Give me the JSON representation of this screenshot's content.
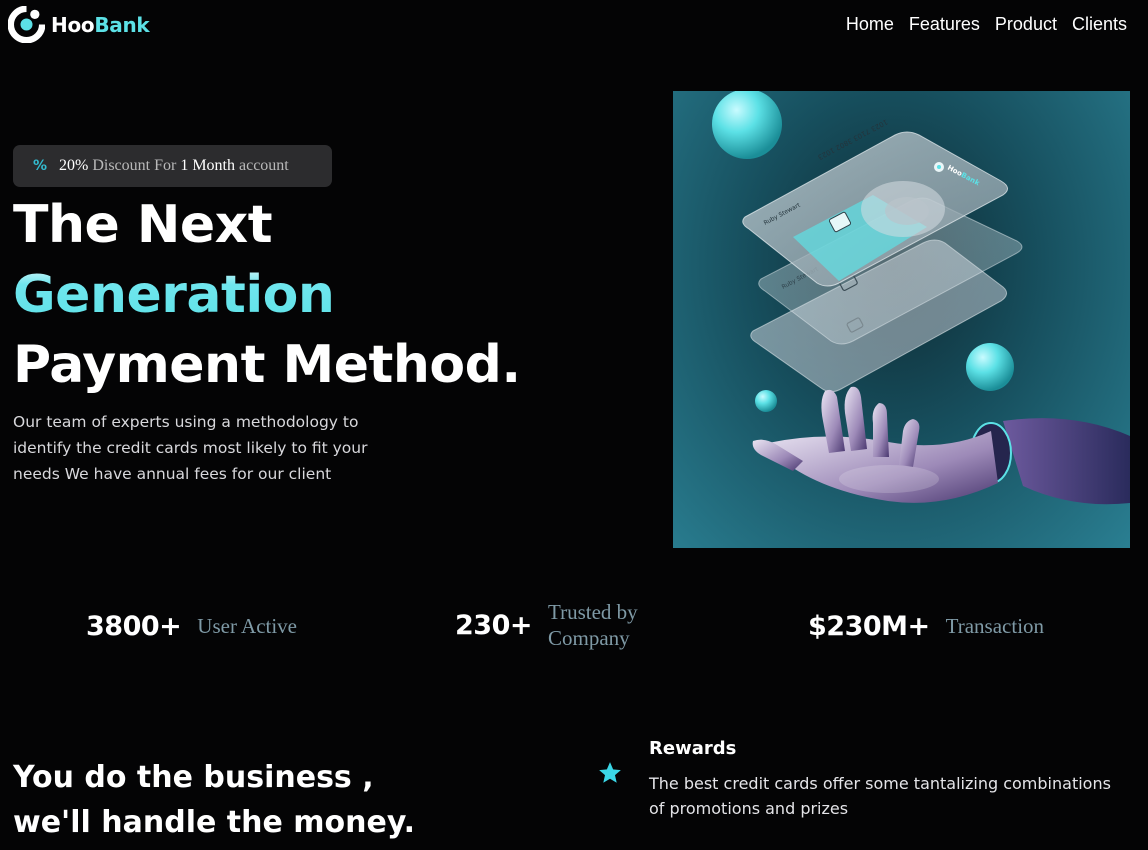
{
  "brand": {
    "name_part1": "Hoo",
    "name_part2": "Bank",
    "accent": "#5ce1e6"
  },
  "nav": {
    "items": [
      "Home",
      "Features",
      "Product",
      "Clients"
    ]
  },
  "hero": {
    "badge": {
      "icon": "discount-icon",
      "percent": "20%",
      "text1": "Discount For",
      "highlight": "1 Month",
      "text2": "account"
    },
    "title": {
      "line1": "The Next",
      "line2": "Generation",
      "line3": "Payment Method."
    },
    "description": "Our team of experts using a methodology to identify the credit cards most likely to fit your needs We have annual fees for our client",
    "art": {
      "card_number": "1023 7103 3802 1023",
      "card_name": "Ruby Stewart",
      "card_brand_part1": "Hoo",
      "card_brand_part2": "Bank"
    }
  },
  "stats": [
    {
      "value": "3800+",
      "label": "User Active"
    },
    {
      "value": "230+",
      "label": "Trusted by Company"
    },
    {
      "value": "$230M+",
      "label": "Transaction"
    }
  ],
  "business": {
    "title_line1": "You do the business ,",
    "title_line2": "we'll handle the money.",
    "features": [
      {
        "icon": "star-icon",
        "title": "Rewards",
        "text": "The best credit cards offer some tantalizing combinations of promotions and prizes"
      }
    ]
  }
}
